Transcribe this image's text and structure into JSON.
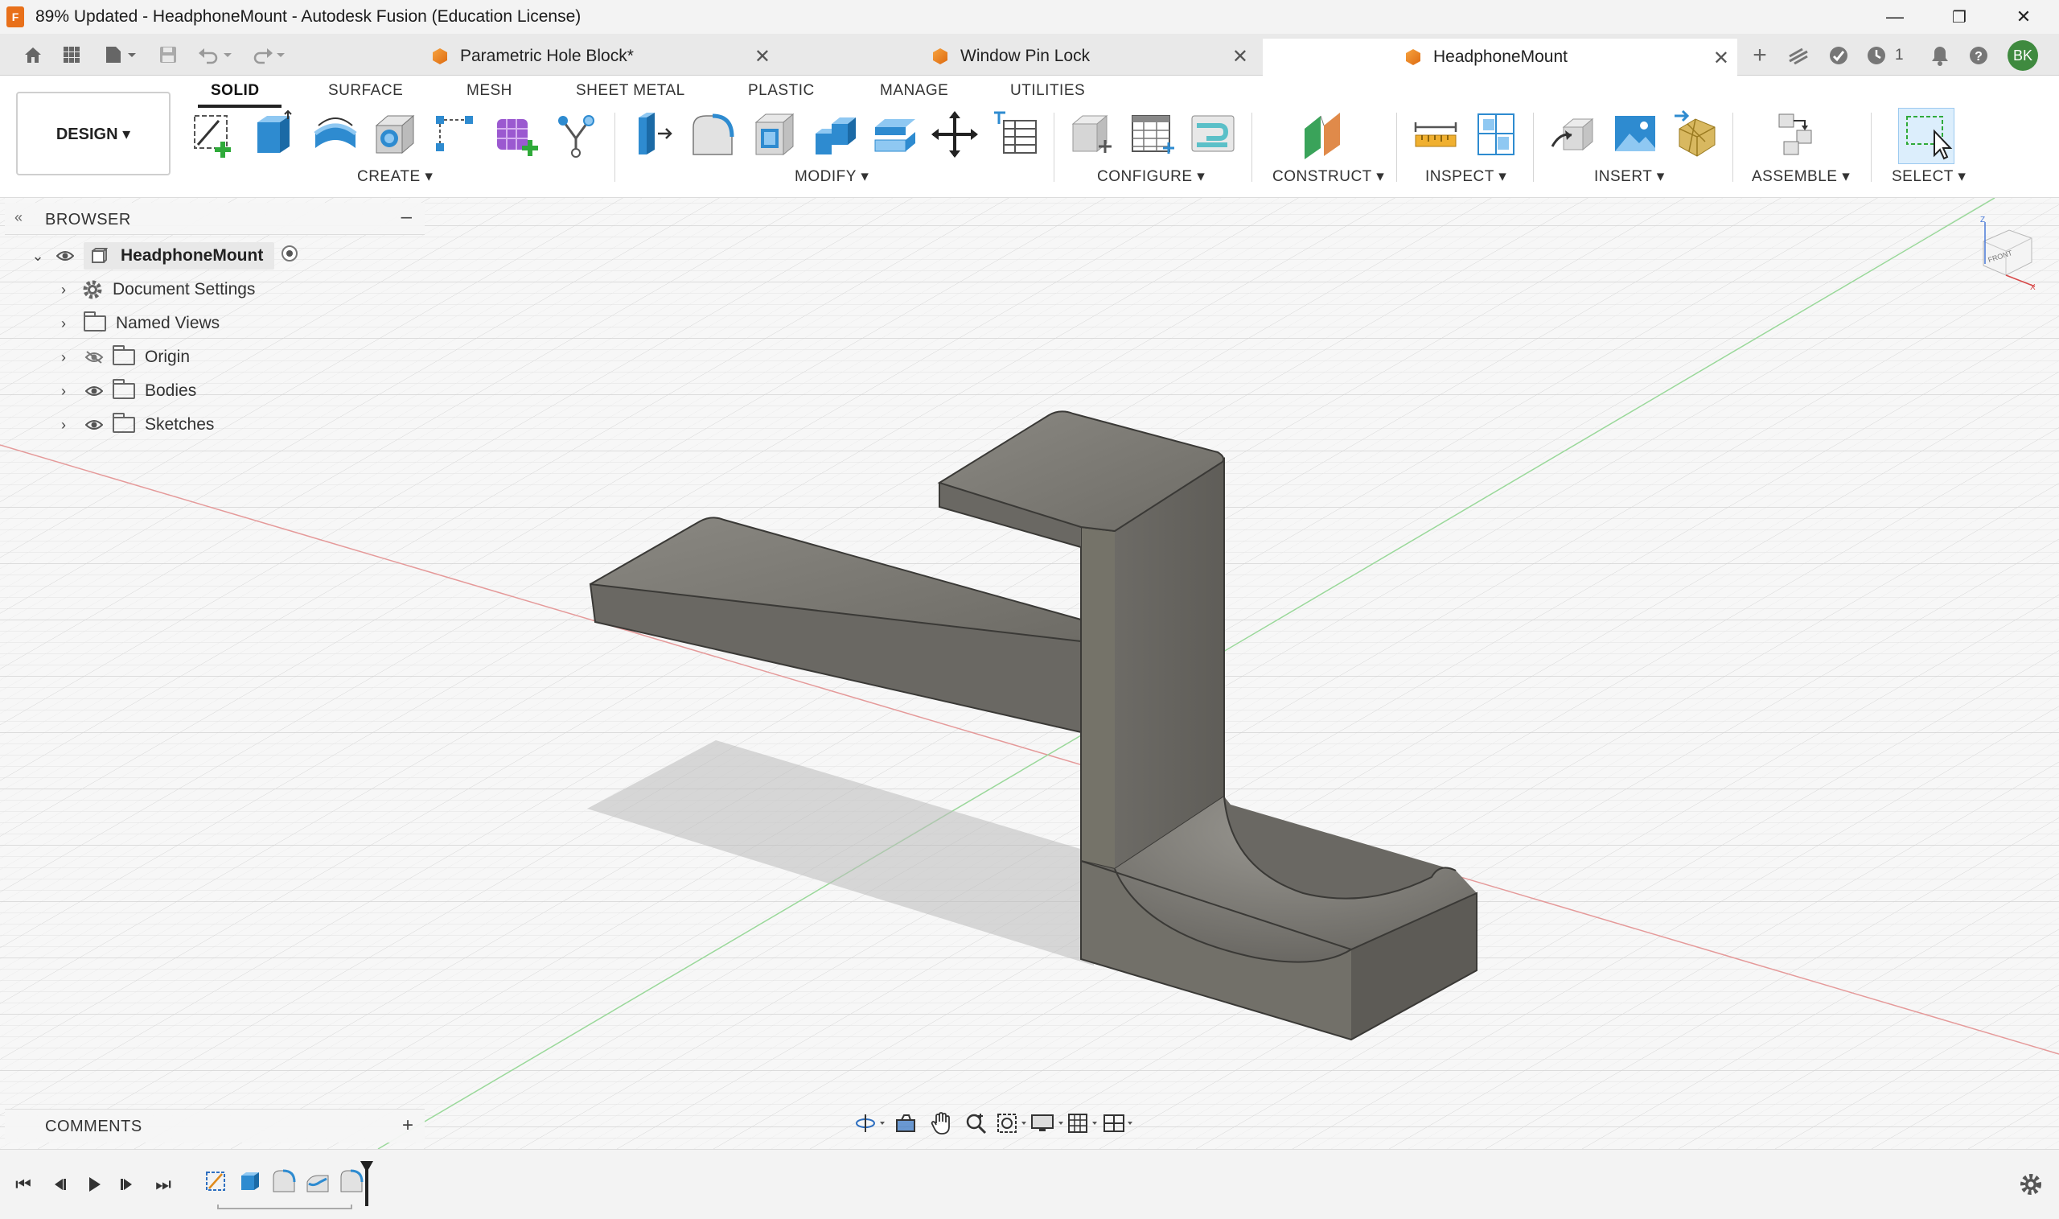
{
  "window": {
    "title": "89% Updated - HeadphoneMount - Autodesk Fusion (Education License)",
    "logo_letter": "F",
    "minimize": "—",
    "restore": "❐",
    "close": "✕"
  },
  "tabs": [
    {
      "label": "Parametric Hole Block*",
      "active": false
    },
    {
      "label": "Window Pin Lock",
      "active": false
    },
    {
      "label": "HeadphoneMount",
      "active": true
    }
  ],
  "tab_close": "✕",
  "top_right": {
    "jobs_count": "1",
    "user_initials": "BK"
  },
  "toolbar": {
    "workspace": "DESIGN ▾",
    "tabs": [
      "SOLID",
      "SURFACE",
      "MESH",
      "SHEET METAL",
      "PLASTIC",
      "MANAGE",
      "UTILITIES"
    ],
    "groups": [
      "CREATE ▾",
      "MODIFY ▾",
      "CONFIGURE ▾",
      "CONSTRUCT ▾",
      "INSPECT ▾",
      "INSERT ▾",
      "ASSEMBLE ▾",
      "SELECT ▾"
    ]
  },
  "browser": {
    "title": "BROWSER",
    "collapse": "–",
    "root": "HeadphoneMount",
    "items": [
      {
        "label": "Document Settings",
        "icon": "gear-icon"
      },
      {
        "label": "Named Views",
        "icon": "folder-icon"
      },
      {
        "label": "Origin",
        "icon": "folder-icon",
        "hidden": true
      },
      {
        "label": "Bodies",
        "icon": "folder-icon"
      },
      {
        "label": "Sketches",
        "icon": "folder-icon"
      }
    ]
  },
  "comments": {
    "title": "COMMENTS",
    "add": "+"
  },
  "viewcube": {
    "face_label": "FRONT",
    "axis_z": "Z",
    "axis_x": "X"
  },
  "colors": {
    "accent_orange": "#e8701a",
    "avatar_green": "#3f8a3f",
    "model_gray": "#7d7b75",
    "axis_red": "#e05050",
    "axis_green": "#50c050",
    "select_blue": "#2e8bd0"
  }
}
